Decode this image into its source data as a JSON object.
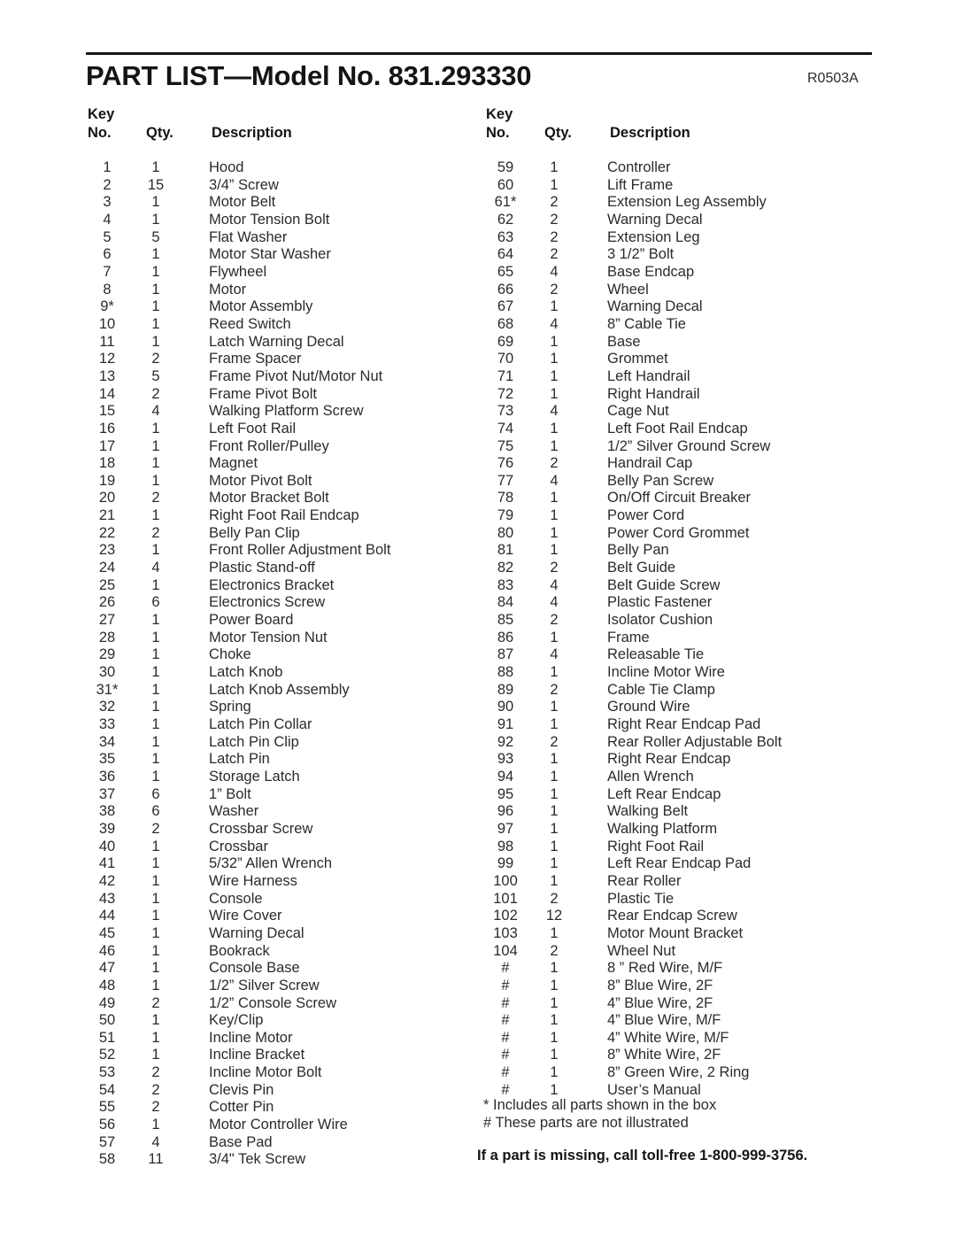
{
  "header": {
    "title": "PART LIST—Model No. 831.293330",
    "revision": "R0503A"
  },
  "column_headers": {
    "key_line1": "Key",
    "key_line2": "No.",
    "qty": "Qty.",
    "description": "Description"
  },
  "left_column": [
    {
      "key": "1",
      "qty": "1",
      "desc": "Hood"
    },
    {
      "key": "2",
      "qty": "15",
      "desc": "3/4” Screw"
    },
    {
      "key": "3",
      "qty": "1",
      "desc": "Motor Belt"
    },
    {
      "key": "4",
      "qty": "1",
      "desc": "Motor Tension Bolt"
    },
    {
      "key": "5",
      "qty": "5",
      "desc": "Flat Washer"
    },
    {
      "key": "6",
      "qty": "1",
      "desc": "Motor Star Washer"
    },
    {
      "key": "7",
      "qty": "1",
      "desc": "Flywheel"
    },
    {
      "key": "8",
      "qty": "1",
      "desc": "Motor"
    },
    {
      "key": "9*",
      "qty": "1",
      "desc": "Motor Assembly"
    },
    {
      "key": "10",
      "qty": "1",
      "desc": "Reed Switch"
    },
    {
      "key": "11",
      "qty": "1",
      "desc": "Latch Warning Decal"
    },
    {
      "key": "12",
      "qty": "2",
      "desc": "Frame Spacer"
    },
    {
      "key": "13",
      "qty": "5",
      "desc": "Frame Pivot Nut/Motor Nut"
    },
    {
      "key": "14",
      "qty": "2",
      "desc": "Frame Pivot Bolt"
    },
    {
      "key": "15",
      "qty": "4",
      "desc": "Walking Platform Screw"
    },
    {
      "key": "16",
      "qty": "1",
      "desc": "Left Foot Rail"
    },
    {
      "key": "17",
      "qty": "1",
      "desc": "Front Roller/Pulley"
    },
    {
      "key": "18",
      "qty": "1",
      "desc": "Magnet"
    },
    {
      "key": "19",
      "qty": "1",
      "desc": "Motor Pivot Bolt"
    },
    {
      "key": "20",
      "qty": "2",
      "desc": "Motor Bracket Bolt"
    },
    {
      "key": "21",
      "qty": "1",
      "desc": "Right Foot Rail Endcap"
    },
    {
      "key": "22",
      "qty": "2",
      "desc": "Belly Pan Clip"
    },
    {
      "key": "23",
      "qty": "1",
      "desc": "Front Roller Adjustment Bolt"
    },
    {
      "key": "24",
      "qty": "4",
      "desc": "Plastic Stand-off"
    },
    {
      "key": "25",
      "qty": "1",
      "desc": "Electronics Bracket"
    },
    {
      "key": "26",
      "qty": "6",
      "desc": "Electronics Screw"
    },
    {
      "key": "27",
      "qty": "1",
      "desc": "Power Board"
    },
    {
      "key": "28",
      "qty": "1",
      "desc": "Motor Tension Nut"
    },
    {
      "key": "29",
      "qty": "1",
      "desc": "Choke"
    },
    {
      "key": "30",
      "qty": "1",
      "desc": "Latch Knob"
    },
    {
      "key": "31*",
      "qty": "1",
      "desc": "Latch Knob Assembly"
    },
    {
      "key": "32",
      "qty": "1",
      "desc": "Spring"
    },
    {
      "key": "33",
      "qty": "1",
      "desc": "Latch Pin Collar"
    },
    {
      "key": "34",
      "qty": "1",
      "desc": "Latch Pin Clip"
    },
    {
      "key": "35",
      "qty": "1",
      "desc": "Latch Pin"
    },
    {
      "key": "36",
      "qty": "1",
      "desc": "Storage Latch"
    },
    {
      "key": "37",
      "qty": "6",
      "desc": "1” Bolt"
    },
    {
      "key": "38",
      "qty": "6",
      "desc": "Washer"
    },
    {
      "key": "39",
      "qty": "2",
      "desc": "Crossbar Screw"
    },
    {
      "key": "40",
      "qty": "1",
      "desc": "Crossbar"
    },
    {
      "key": "41",
      "qty": "1",
      "desc": "5/32” Allen Wrench"
    },
    {
      "key": "42",
      "qty": "1",
      "desc": "Wire Harness"
    },
    {
      "key": "43",
      "qty": "1",
      "desc": "Console"
    },
    {
      "key": "44",
      "qty": "1",
      "desc": "Wire Cover"
    },
    {
      "key": "45",
      "qty": "1",
      "desc": "Warning Decal"
    },
    {
      "key": "46",
      "qty": "1",
      "desc": "Bookrack"
    },
    {
      "key": "47",
      "qty": "1",
      "desc": "Console Base"
    },
    {
      "key": "48",
      "qty": "1",
      "desc": "1/2” Silver Screw"
    },
    {
      "key": "49",
      "qty": "2",
      "desc": "1/2” Console Screw"
    },
    {
      "key": "50",
      "qty": "1",
      "desc": "Key/Clip"
    },
    {
      "key": "51",
      "qty": "1",
      "desc": "Incline Motor"
    },
    {
      "key": "52",
      "qty": "1",
      "desc": "Incline Bracket"
    },
    {
      "key": "53",
      "qty": "2",
      "desc": "Incline Motor Bolt"
    },
    {
      "key": "54",
      "qty": "2",
      "desc": "Clevis Pin"
    },
    {
      "key": "55",
      "qty": "2",
      "desc": "Cotter Pin"
    },
    {
      "key": "56",
      "qty": "1",
      "desc": "Motor Controller Wire"
    },
    {
      "key": "57",
      "qty": "4",
      "desc": "Base Pad"
    },
    {
      "key": "58",
      "qty": "11",
      "desc": "3/4\" Tek Screw"
    }
  ],
  "right_column": [
    {
      "key": "59",
      "qty": "1",
      "desc": "Controller"
    },
    {
      "key": "60",
      "qty": "1",
      "desc": "Lift Frame"
    },
    {
      "key": "61*",
      "qty": "2",
      "desc": "Extension Leg Assembly"
    },
    {
      "key": "62",
      "qty": "2",
      "desc": "Warning Decal"
    },
    {
      "key": "63",
      "qty": "2",
      "desc": "Extension Leg"
    },
    {
      "key": "64",
      "qty": "2",
      "desc": "3 1/2” Bolt"
    },
    {
      "key": "65",
      "qty": "4",
      "desc": "Base Endcap"
    },
    {
      "key": "66",
      "qty": "2",
      "desc": "Wheel"
    },
    {
      "key": "67",
      "qty": "1",
      "desc": "Warning Decal"
    },
    {
      "key": "68",
      "qty": "4",
      "desc": "8” Cable Tie"
    },
    {
      "key": "69",
      "qty": "1",
      "desc": "Base"
    },
    {
      "key": "70",
      "qty": "1",
      "desc": "Grommet"
    },
    {
      "key": "71",
      "qty": "1",
      "desc": "Left Handrail"
    },
    {
      "key": "72",
      "qty": "1",
      "desc": "Right Handrail"
    },
    {
      "key": "73",
      "qty": "4",
      "desc": "Cage Nut"
    },
    {
      "key": "74",
      "qty": "1",
      "desc": "Left Foot Rail Endcap"
    },
    {
      "key": "75",
      "qty": "1",
      "desc": "1/2” Silver Ground Screw"
    },
    {
      "key": "76",
      "qty": "2",
      "desc": "Handrail Cap"
    },
    {
      "key": "77",
      "qty": "4",
      "desc": "Belly Pan Screw"
    },
    {
      "key": "78",
      "qty": "1",
      "desc": "On/Off Circuit Breaker"
    },
    {
      "key": "79",
      "qty": "1",
      "desc": "Power Cord"
    },
    {
      "key": "80",
      "qty": "1",
      "desc": "Power Cord Grommet"
    },
    {
      "key": "81",
      "qty": "1",
      "desc": "Belly Pan"
    },
    {
      "key": "82",
      "qty": "2",
      "desc": "Belt Guide"
    },
    {
      "key": "83",
      "qty": "4",
      "desc": "Belt Guide Screw"
    },
    {
      "key": "84",
      "qty": "4",
      "desc": "Plastic Fastener"
    },
    {
      "key": "85",
      "qty": "2",
      "desc": "Isolator Cushion"
    },
    {
      "key": "86",
      "qty": "1",
      "desc": "Frame"
    },
    {
      "key": "87",
      "qty": "4",
      "desc": "Releasable Tie"
    },
    {
      "key": "88",
      "qty": "1",
      "desc": "Incline Motor Wire"
    },
    {
      "key": "89",
      "qty": "2",
      "desc": "Cable Tie Clamp"
    },
    {
      "key": "90",
      "qty": "1",
      "desc": "Ground Wire"
    },
    {
      "key": "91",
      "qty": "1",
      "desc": "Right Rear Endcap Pad"
    },
    {
      "key": "92",
      "qty": "2",
      "desc": "Rear Roller Adjustable Bolt"
    },
    {
      "key": "93",
      "qty": "1",
      "desc": "Right Rear Endcap"
    },
    {
      "key": "94",
      "qty": "1",
      "desc": "Allen Wrench"
    },
    {
      "key": "95",
      "qty": "1",
      "desc": "Left Rear Endcap"
    },
    {
      "key": "96",
      "qty": "1",
      "desc": "Walking Belt"
    },
    {
      "key": "97",
      "qty": "1",
      "desc": "Walking Platform"
    },
    {
      "key": "98",
      "qty": "1",
      "desc": "Right Foot Rail"
    },
    {
      "key": "99",
      "qty": "1",
      "desc": "Left Rear Endcap Pad"
    },
    {
      "key": "100",
      "qty": "1",
      "desc": "Rear Roller"
    },
    {
      "key": "101",
      "qty": "2",
      "desc": "Plastic Tie"
    },
    {
      "key": "102",
      "qty": "12",
      "desc": "Rear Endcap Screw"
    },
    {
      "key": "103",
      "qty": "1",
      "desc": "Motor Mount Bracket"
    },
    {
      "key": "104",
      "qty": "2",
      "desc": "Wheel Nut"
    },
    {
      "key": "#",
      "qty": "1",
      "desc": "8 ” Red Wire, M/F"
    },
    {
      "key": "#",
      "qty": "1",
      "desc": "8” Blue Wire, 2F"
    },
    {
      "key": "#",
      "qty": "1",
      "desc": "4” Blue Wire, 2F"
    },
    {
      "key": "#",
      "qty": "1",
      "desc": "4” Blue Wire, M/F"
    },
    {
      "key": "#",
      "qty": "1",
      "desc": "4” White Wire, M/F"
    },
    {
      "key": "#",
      "qty": "1",
      "desc": "8” White Wire, 2F"
    },
    {
      "key": "#",
      "qty": "1",
      "desc": "8” Green Wire, 2 Ring"
    },
    {
      "key": "#",
      "qty": "1",
      "desc": "User’s Manual"
    }
  ],
  "footnotes": [
    "* Includes all parts shown in the box",
    "# These parts are not illustrated"
  ],
  "missing_part_note": "If a part is missing, call toll-free 1-800-999-3756."
}
